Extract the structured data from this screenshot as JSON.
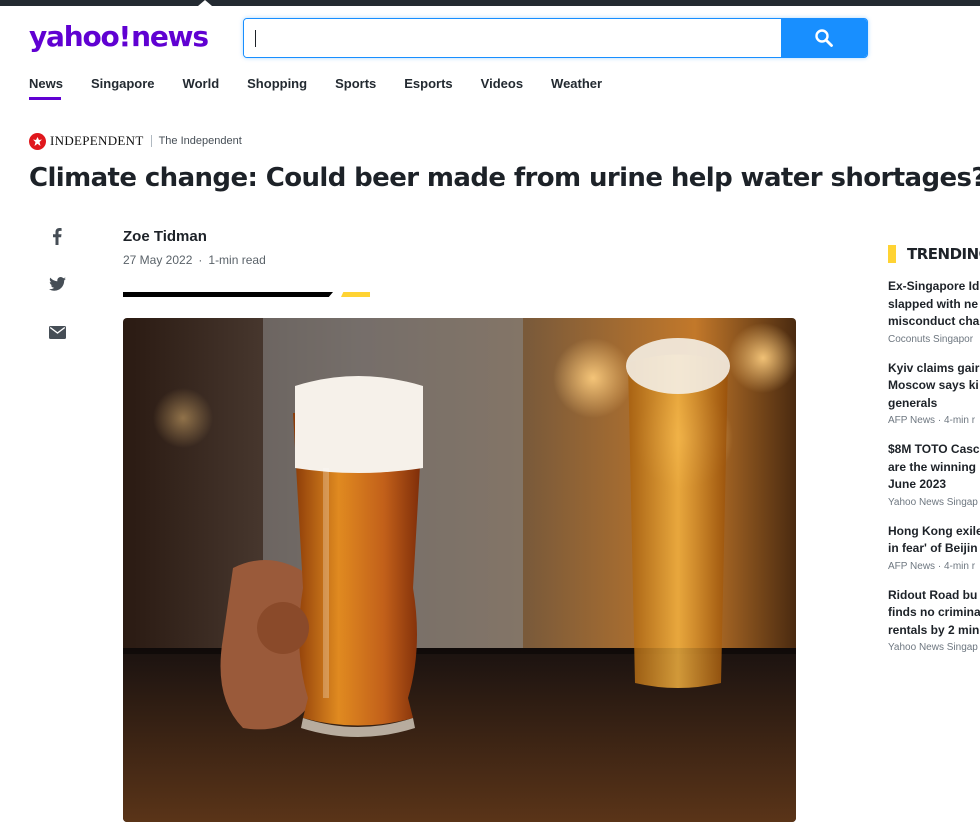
{
  "brand": {
    "logo_main": "yahoo!",
    "logo_sub": "news"
  },
  "search": {
    "value": "",
    "placeholder": ""
  },
  "nav": [
    {
      "label": "News",
      "active": true
    },
    {
      "label": "Singapore"
    },
    {
      "label": "World"
    },
    {
      "label": "Shopping"
    },
    {
      "label": "Sports"
    },
    {
      "label": "Esports"
    },
    {
      "label": "Videos"
    },
    {
      "label": "Weather"
    }
  ],
  "article": {
    "publisher_logo_text": "INDEPENDENT",
    "publisher_name": "The Independent",
    "headline": "Climate change: Could beer made from urine help water shortages?",
    "author": "Zoe Tidman",
    "date": "27 May 2022",
    "read_time": "1-min read",
    "hero_image": "beer glasses on bar counter"
  },
  "share": [
    "facebook-icon",
    "twitter-icon",
    "mail-icon"
  ],
  "trending": {
    "title": "TRENDING",
    "items": [
      {
        "title": "Ex-Singapore Id... slapped with ne... misconduct cha...",
        "lines": [
          "Ex-Singapore Id",
          "slapped with ne",
          "misconduct cha"
        ],
        "source": "Coconuts Singapor"
      },
      {
        "lines": [
          "Kyiv claims gair",
          "Moscow says ki",
          "generals"
        ],
        "source": "AFP News · 4-min r"
      },
      {
        "lines": [
          "$8M TOTO Casc",
          "are the winning",
          "June 2023"
        ],
        "source": "Yahoo News Singap"
      },
      {
        "lines": [
          "Hong Kong exile",
          "in fear' of Beijin"
        ],
        "source": "AFP News · 4-min r"
      },
      {
        "lines": [
          "Ridout Road bu",
          "finds no crimina",
          "rentals by 2 min"
        ],
        "source": "Yahoo News Singap"
      }
    ]
  },
  "colors": {
    "brand_purple": "#6001d2",
    "search_blue": "#188fff",
    "accent_yellow": "#ffd333",
    "independent_red": "#e0171c"
  }
}
